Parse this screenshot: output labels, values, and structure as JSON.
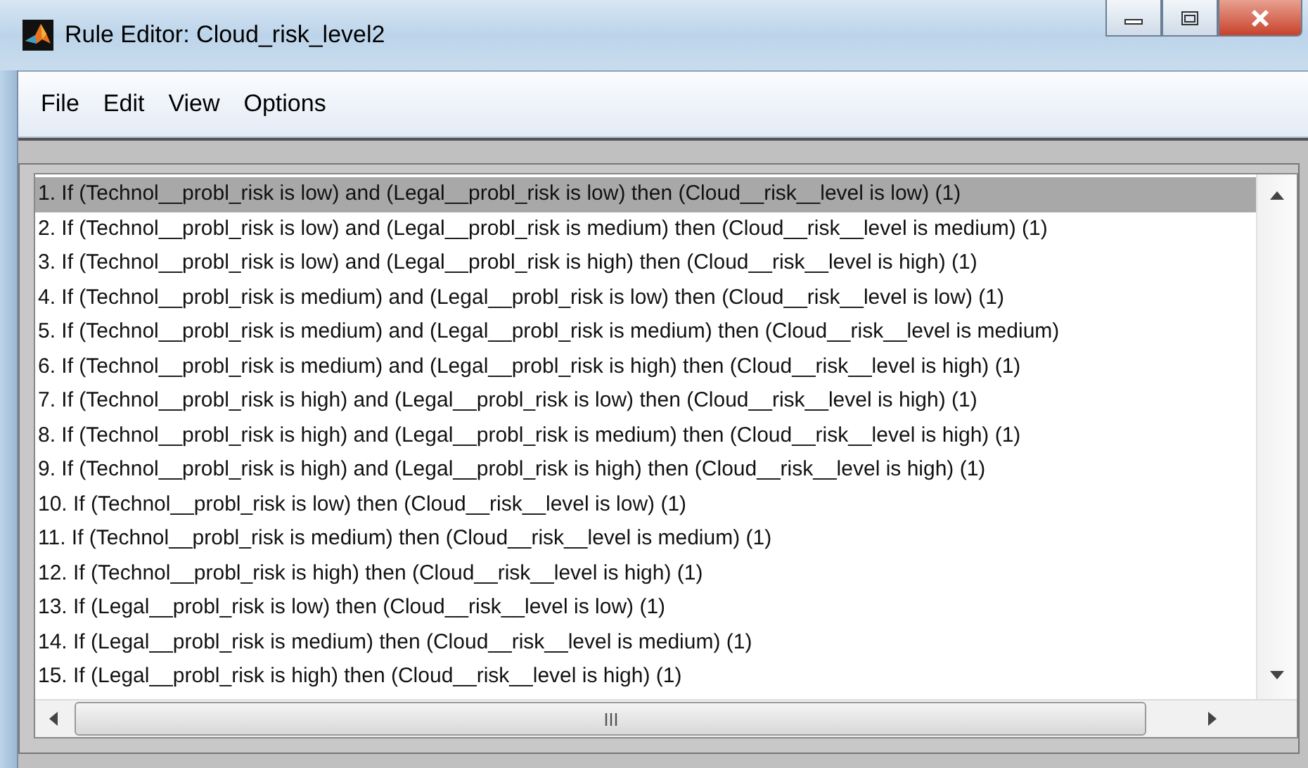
{
  "window": {
    "title": "Rule Editor: Cloud_risk_level2"
  },
  "menu": [
    {
      "label": "File"
    },
    {
      "label": "Edit"
    },
    {
      "label": "View"
    },
    {
      "label": "Options"
    }
  ],
  "rules": [
    {
      "text": "1. If (Technol__probl_risk is low) and (Legal__probl_risk is low) then (Cloud__risk__level is low) (1)",
      "selected": true
    },
    {
      "text": "2. If (Technol__probl_risk is low) and (Legal__probl_risk is medium) then (Cloud__risk__level is medium) (1)",
      "selected": false
    },
    {
      "text": "3. If (Technol__probl_risk is low) and (Legal__probl_risk is high) then (Cloud__risk__level is high) (1)",
      "selected": false
    },
    {
      "text": "4. If (Technol__probl_risk is medium) and (Legal__probl_risk is low) then (Cloud__risk__level is low) (1)",
      "selected": false
    },
    {
      "text": "5. If (Technol__probl_risk is medium) and (Legal__probl_risk is medium) then (Cloud__risk__level is medium)",
      "selected": false
    },
    {
      "text": "6. If (Technol__probl_risk is medium) and (Legal__probl_risk is high) then (Cloud__risk__level is high) (1)",
      "selected": false
    },
    {
      "text": "7. If (Technol__probl_risk is high) and (Legal__probl_risk is low) then (Cloud__risk__level is high) (1)",
      "selected": false
    },
    {
      "text": "8. If (Technol__probl_risk is high) and (Legal__probl_risk is medium) then (Cloud__risk__level is high) (1)",
      "selected": false
    },
    {
      "text": "9. If (Technol__probl_risk is high) and (Legal__probl_risk is high) then (Cloud__risk__level is high) (1)",
      "selected": false
    },
    {
      "text": "10. If (Technol__probl_risk is low) then (Cloud__risk__level is low) (1)",
      "selected": false
    },
    {
      "text": "11. If (Technol__probl_risk is medium) then (Cloud__risk__level is medium) (1)",
      "selected": false
    },
    {
      "text": "12. If (Technol__probl_risk is high) then (Cloud__risk__level is high) (1)",
      "selected": false
    },
    {
      "text": "13. If (Legal__probl_risk is low) then (Cloud__risk__level is low) (1)",
      "selected": false
    },
    {
      "text": "14. If (Legal__probl_risk is medium) then (Cloud__risk__level is medium) (1)",
      "selected": false
    },
    {
      "text": "15. If (Legal__probl_risk is high) then (Cloud__risk__level is high) (1)",
      "selected": false
    }
  ]
}
